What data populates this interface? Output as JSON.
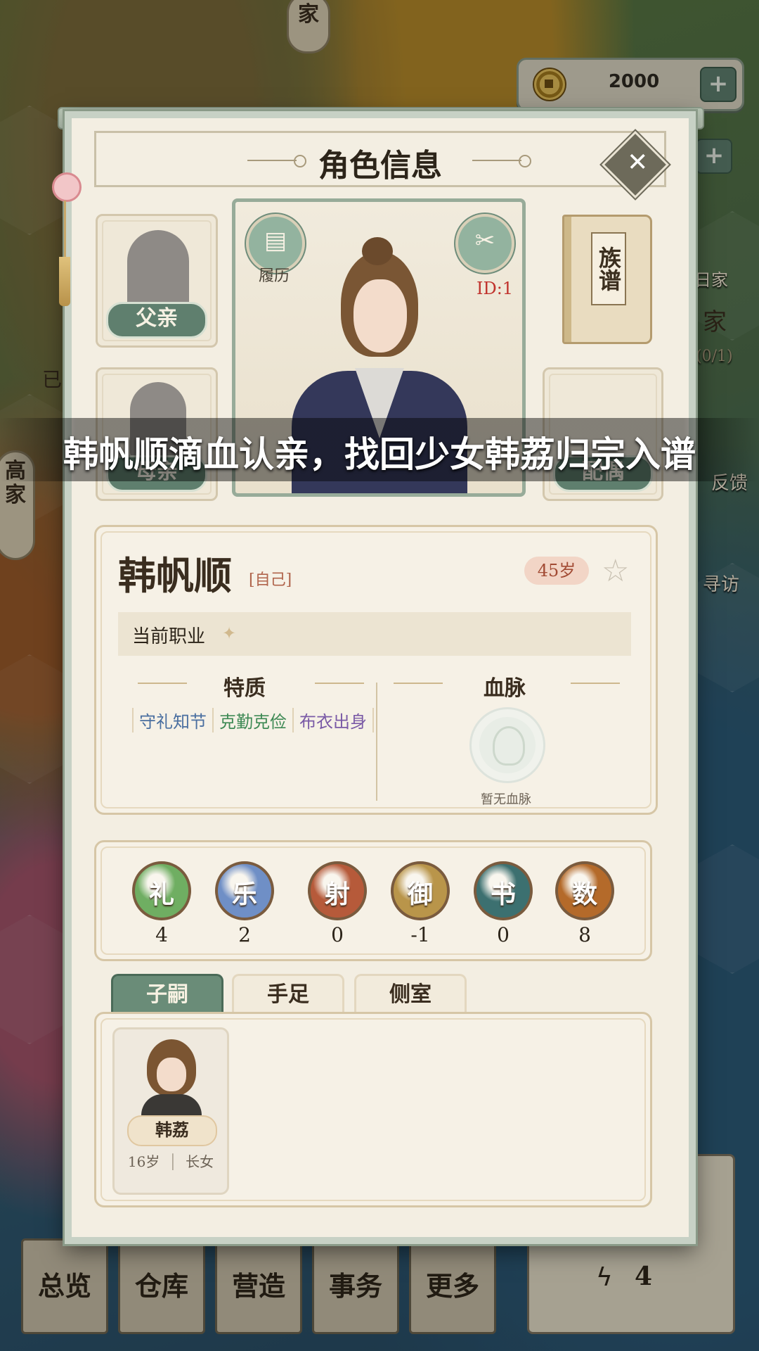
{
  "hud": {
    "coins": "2000",
    "plus": "+",
    "side_labels": [
      "家",
      "日家",
      "家",
      "(0/1)",
      "反馈",
      "寻访"
    ],
    "left_tab": "高家",
    "left_small": "已"
  },
  "modal": {
    "title": "角色信息",
    "close": "✕",
    "slots": {
      "father": "父亲",
      "mother": "母亲",
      "spouse": "配偶"
    },
    "resume": "履历",
    "id": "ID:1",
    "genealogy": "族谱"
  },
  "banner": "韩帆顺滴血认亲，找回少女韩荔归宗入谱",
  "character": {
    "name": "韩帆顺",
    "relation": "[自己]",
    "age": "45岁",
    "job_label": "当前职业",
    "traits_title": "特质",
    "bloodline_title": "血脉",
    "traits": [
      {
        "label": "守礼知节",
        "color": "#4a6fa0"
      },
      {
        "label": "克勤克俭",
        "color": "#3f8a55"
      },
      {
        "label": "布衣出身",
        "color": "#7a5aa6"
      }
    ],
    "no_bloodline": "暂无血脉"
  },
  "skills": [
    {
      "glyph": "礼",
      "value": "4",
      "color": "#6fae62"
    },
    {
      "glyph": "乐",
      "value": "2",
      "color": "#6f8fc6"
    },
    {
      "glyph": "射",
      "value": "0",
      "color": "#b65a3a"
    },
    {
      "glyph": "御",
      "value": "-1",
      "color": "#b9954a"
    },
    {
      "glyph": "书",
      "value": "0",
      "color": "#3c7070"
    },
    {
      "glyph": "数",
      "value": "8",
      "color": "#b46a2a"
    }
  ],
  "tabs": [
    "子嗣",
    "手足",
    "侧室"
  ],
  "children": [
    {
      "name": "韩荔",
      "age": "16岁",
      "rank": "长女",
      "sep": "│"
    }
  ],
  "bottom_nav": [
    "总览",
    "仓库",
    "营造",
    "事务",
    "更多"
  ],
  "energy": "4"
}
